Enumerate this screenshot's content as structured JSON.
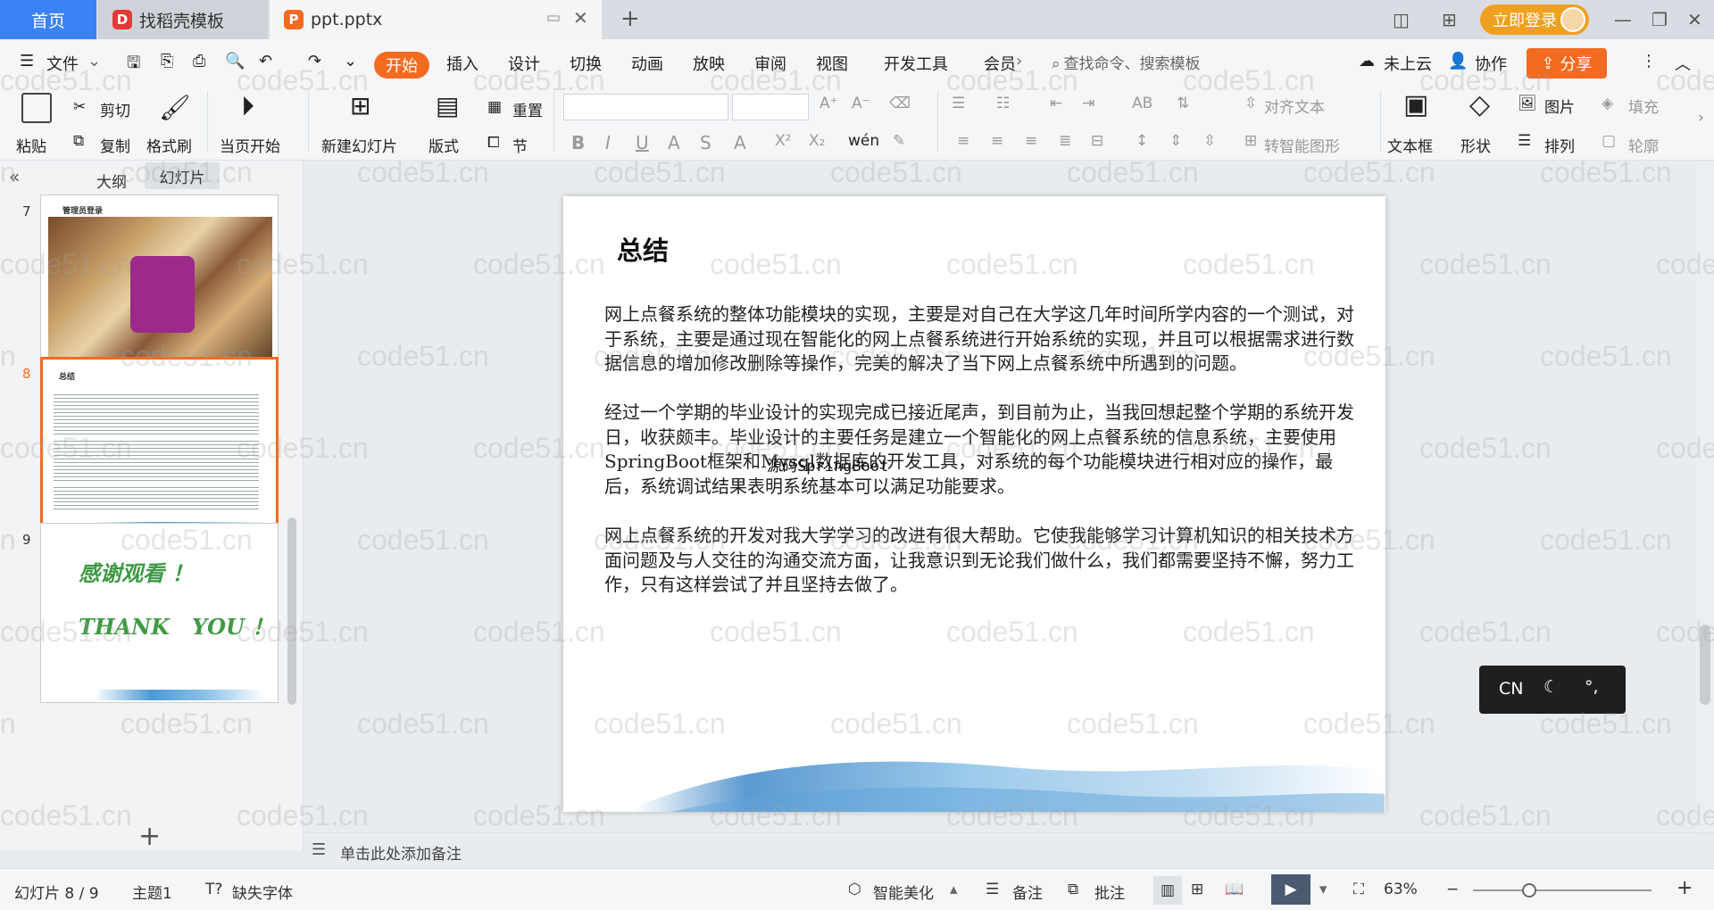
{
  "titlebar": {
    "tab_home": "首页",
    "tab_template": "找稻壳模板",
    "tab_file": "ppt.pptx",
    "login": "立即登录"
  },
  "menubar": {
    "file": "文件",
    "items": [
      "开始",
      "插入",
      "设计",
      "切换",
      "动画",
      "放映",
      "审阅",
      "视图",
      "开发工具",
      "会员"
    ],
    "search_placeholder": "查找命令、搜索模板",
    "cloud": "未上云",
    "collab": "协作",
    "share": "分享"
  },
  "ribbon": {
    "paste": "粘贴",
    "cut": "剪切",
    "copy": "复制",
    "format_painter": "格式刷",
    "from_current": "当页开始",
    "new_slide": "新建幻灯片",
    "layout": "版式",
    "reset": "重置",
    "section": "节",
    "align_text": "对齐文本",
    "smartart": "转智能图形",
    "textbox": "文本框",
    "shape": "形状",
    "picture": "图片",
    "arrange": "排列",
    "fill": "填充",
    "outline": "轮廓"
  },
  "leftpanel": {
    "tab_outline": "大纲",
    "tab_slides": "幻灯片",
    "slides": [
      {
        "num": "7",
        "title": "管理员登录"
      },
      {
        "num": "8",
        "title": "总结"
      },
      {
        "num": "9",
        "line1": "感谢观看 ！",
        "line2": "THANK   YOU ！"
      }
    ]
  },
  "slide": {
    "title": "总结",
    "paragraphs": [
      "网上点餐系统的整体功能模块的实现，主要是对自己在大学这几年时间所学内容的一个测试，对于系统，主要是通过现在智能化的网上点餐系统进行开始系统的实现，并且可以根据需求进行数据信息的增加修改删除等操作，完美的解决了当下网上点餐系统中所遇到的问题。",
      "经过一个学期的毕业设计的实现完成已接近尾声，到目前为止，当我回想起整个学期的系统开发日，收获颇丰。毕业设计的主要任务是建立一个智能化的网上点餐系统的信息系统，主要使用SpringBoot框架和Mysql数据库的开发工具，对系统的每个功能模块进行相对应的操作，最后，系统调试结果表明系统基本可以满足功能要求。",
      "网上点餐系统的开发对我大学学习的改进有很大帮助。它使我能够学习计算机知识的相关技术方面问题及与人交往的沟通交流方面，让我意识到无论我们做什么，我们都需要坚持不懈，努力工作，只有这样尝试了并且坚持去做了。"
    ],
    "overlap": "源码SpringBoot"
  },
  "notes": {
    "placeholder": "单击此处添加备注"
  },
  "statusbar": {
    "slide_count": "幻灯片 8 / 9",
    "theme": "主题1",
    "missing_font": "缺失字体",
    "beautify": "智能美化",
    "notes": "备注",
    "comments": "批注",
    "zoom": "63%"
  },
  "ime": {
    "lang": "CN"
  },
  "watermark": "code51.cn"
}
